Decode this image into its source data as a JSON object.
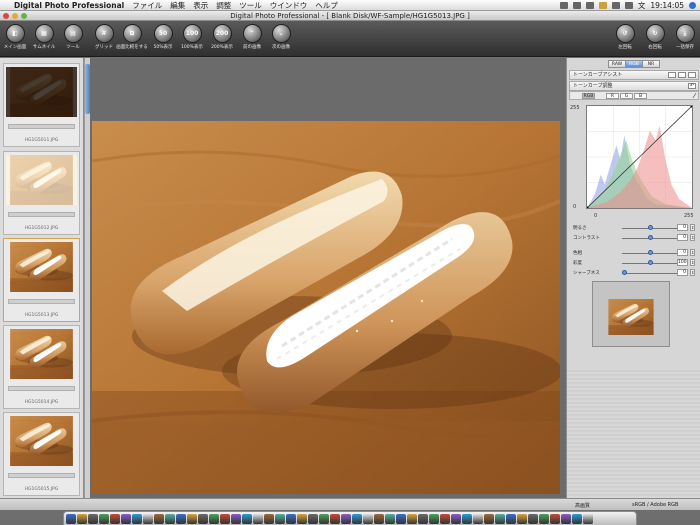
{
  "menubar": {
    "apple": "",
    "app_name": "Digital Photo Professional",
    "items": [
      "ファイル",
      "編集",
      "表示",
      "調整",
      "ツール",
      "ウインドウ",
      "ヘルプ"
    ],
    "clock": "19:14:05"
  },
  "window": {
    "title": "Digital Photo Professional - [ Blank Disk/WF-Sample/HG1G5013.JPG ]"
  },
  "toolbar": {
    "left": [
      {
        "label": "メイン画面",
        "icon": "main-window-icon",
        "glyph": "◧"
      },
      {
        "label": "サムネイル",
        "icon": "thumbnail-icon",
        "glyph": "▦"
      },
      {
        "label": "ツール",
        "icon": "tool-palette-icon",
        "glyph": "▤"
      },
      {
        "label": "グリッド",
        "icon": "grid-icon",
        "glyph": "#"
      },
      {
        "label": "画面比較をする",
        "icon": "compare-icon",
        "glyph": "⧉"
      },
      {
        "label": "50%表示",
        "icon": "zoom-50-icon",
        "glyph": "50"
      },
      {
        "label": "100%表示",
        "icon": "zoom-100-icon",
        "glyph": "100"
      },
      {
        "label": "200%表示",
        "icon": "zoom-200-icon",
        "glyph": "200"
      },
      {
        "label": "前の画像",
        "icon": "previous-image-icon",
        "glyph": "⌃"
      },
      {
        "label": "次の画像",
        "icon": "next-image-icon",
        "glyph": "⌄"
      }
    ],
    "right": [
      {
        "label": "左回転",
        "icon": "rotate-left-icon",
        "glyph": "↺"
      },
      {
        "label": "右回転",
        "icon": "rotate-right-icon",
        "glyph": "↻"
      },
      {
        "label": "一括保存",
        "icon": "batch-save-icon",
        "glyph": "⤓"
      }
    ]
  },
  "thumbnails": [
    {
      "caption": "HG1G5011.JPG",
      "tone": "dark"
    },
    {
      "caption": "HG1G5012.JPG",
      "tone": "bright"
    },
    {
      "caption": "HG1G5013.JPG",
      "tone": "normal"
    },
    {
      "caption": "HG1G5014.JPG",
      "tone": "normal"
    },
    {
      "caption": "HG1G5015.JPG",
      "tone": "normal"
    }
  ],
  "panel": {
    "tabs": [
      "RAW",
      "RGB",
      "NR"
    ],
    "selected_tab": "RGB",
    "tone_curve_assist": "トーンカーブアシスト",
    "tone_curve_adjust": "トーンカーブ調整",
    "channels": [
      "RGB",
      "R",
      "G",
      "B"
    ],
    "selected_channel": "RGB",
    "curve_max": "255",
    "curve_min": "0",
    "axis_start": "0",
    "axis_end": "255",
    "sliders": [
      {
        "label": "明るさ",
        "value": "0",
        "level": 0.5
      },
      {
        "label": "コントラスト",
        "value": "0",
        "level": 0.5
      },
      {
        "label": "色相",
        "value": "0",
        "level": 0.5
      },
      {
        "label": "彩度",
        "value": "100",
        "level": 0.5
      },
      {
        "label": "シャープネス",
        "value": "0",
        "level": 0.0
      }
    ]
  },
  "status": {
    "quality": "高画質",
    "colorspace": "sRGB / Adobe RGB"
  },
  "colors": {
    "accent": "#5b8fd0",
    "toolbar_bg": "#3c3c3c",
    "wood": "#b87a3a"
  },
  "dock_count": 48
}
